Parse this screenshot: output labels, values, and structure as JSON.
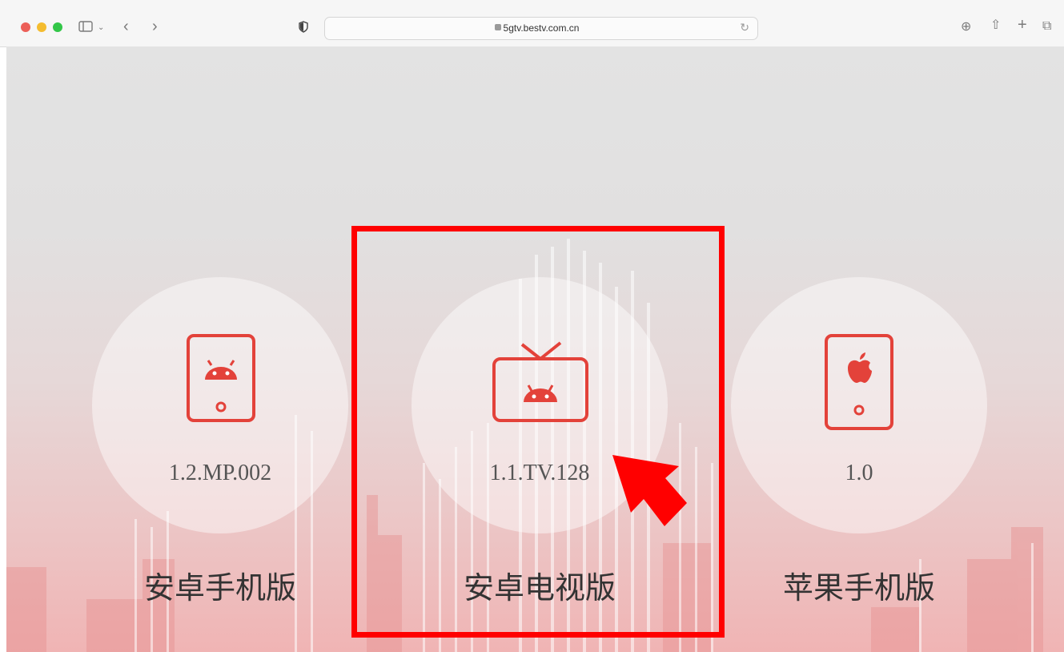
{
  "browser": {
    "url": "5gtv.bestv.com.cn"
  },
  "apps": [
    {
      "version": "1.2.MP.002",
      "label": "安卓手机版",
      "icon": "android-phone-icon"
    },
    {
      "version": "1.1.TV.128",
      "label": "安卓电视版",
      "icon": "android-tv-icon"
    },
    {
      "version": "1.0",
      "label": "苹果手机版",
      "icon": "apple-phone-icon"
    }
  ],
  "colors": {
    "accent": "#e3423a",
    "highlight": "#ff0000"
  }
}
